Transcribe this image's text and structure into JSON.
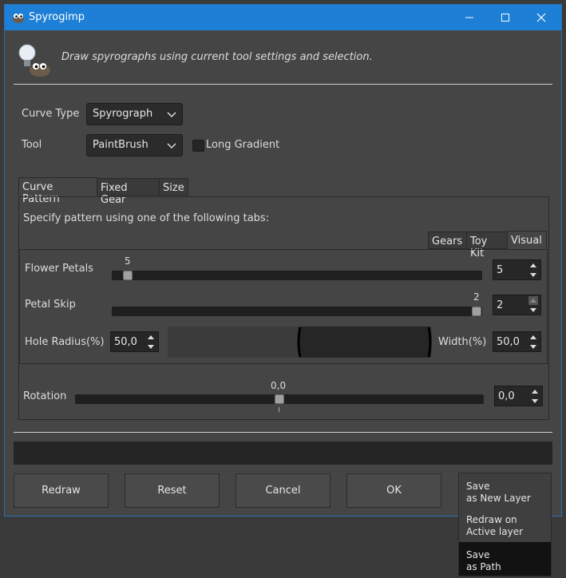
{
  "window": {
    "title": "Spyrogimp",
    "description": "Draw spyrographs using current tool settings and selection."
  },
  "form": {
    "curve_type_label": "Curve Type",
    "curve_type_value": "Spyrograph",
    "tool_label": "Tool",
    "tool_value": "PaintBrush",
    "long_gradient_label": "Long Gradient",
    "long_gradient_checked": false
  },
  "tabs": [
    {
      "label": "Curve Pattern",
      "active": true
    },
    {
      "label": "Fixed Gear",
      "active": false
    },
    {
      "label": "Size",
      "active": false
    }
  ],
  "pattern": {
    "intro": "Specify pattern using one of the following tabs:",
    "subtabs": [
      {
        "label": "Gears",
        "active": false
      },
      {
        "label": "Toy Kit",
        "active": false
      },
      {
        "label": "Visual",
        "active": true
      }
    ],
    "flower_petals": {
      "label": "Flower Petals",
      "value": "5",
      "min": 2,
      "max": 2
    },
    "petal_skip": {
      "label": "Petal Skip",
      "value": "2"
    },
    "hole_radius": {
      "label": "Hole Radius(%)",
      "value": "50,0"
    },
    "width": {
      "label": "Width(%)",
      "value": "50,0"
    }
  },
  "rotation": {
    "label": "Rotation",
    "value": "0,0"
  },
  "buttons": {
    "redraw": "Redraw",
    "reset": "Reset",
    "cancel": "Cancel",
    "ok": "OK"
  },
  "ok_menu": [
    {
      "line1": "Save",
      "line2": "as New Layer"
    },
    {
      "line1": "Redraw on",
      "line2": "Active layer"
    },
    {
      "line1": "Save",
      "line2": "as Path"
    }
  ],
  "colors": {
    "titlebar": "#1e7fd6",
    "window_bg": "#454545",
    "selected_menu": "#121212"
  },
  "icons": [
    "gimp-app-icon",
    "minimize-icon",
    "maximize-icon",
    "close-icon",
    "plugin-lightbulb-icon",
    "chevron-down-icon",
    "spin-up-icon",
    "spin-down-icon"
  ]
}
